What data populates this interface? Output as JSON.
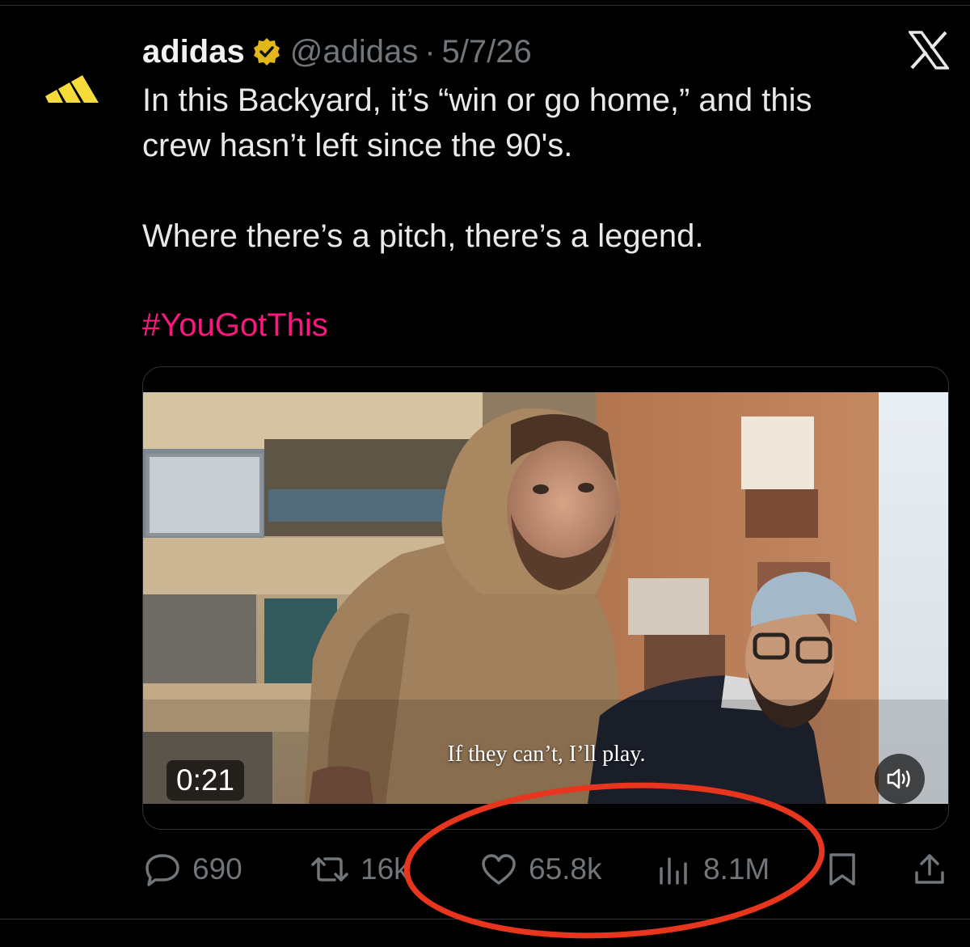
{
  "tweet": {
    "author": {
      "display_name": "adidas",
      "handle": "@adidas",
      "verified": true,
      "avatar_icon": "adidas-three-bars-logo",
      "brand_color": "#f6dc3b"
    },
    "separator": "·",
    "date": "5/7/26",
    "text": "In this Backyard, it’s “win or go home,” and this\ncrew hasn’t left since the 90's.\n\nWhere there’s a pitch, there’s a legend.",
    "hashtag": "#YouGotThis",
    "hashtag_color": "#f91880",
    "media": {
      "subtitle": "If they can’t, I’ll play.",
      "duration": "0:21",
      "mute_icon": "speaker-icon"
    },
    "actions": {
      "replies": "690",
      "reposts": "16k",
      "likes": "65.8k",
      "views": "8.1M"
    }
  },
  "platform_icon": "x-logo",
  "annotation": {
    "shape": "ellipse",
    "color": "#e8351e"
  }
}
